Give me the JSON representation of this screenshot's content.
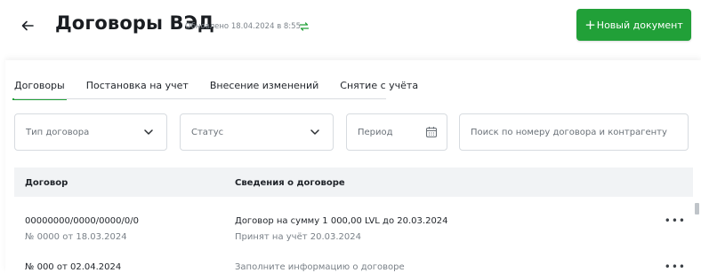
{
  "header": {
    "title": "Договоры ВЭД",
    "updated": "Обновлено 18.04.2024 в 8:55",
    "new_document_label": "Новый документ",
    "back_icon": "arrow-left-icon",
    "refresh_icon": "refresh-icon",
    "accent_color": "#21a038"
  },
  "tabs": [
    {
      "label": "Договоры",
      "active": true
    },
    {
      "label": "Постановка на учет",
      "active": false
    },
    {
      "label": "Внесение изменений",
      "active": false
    },
    {
      "label": "Снятие с учёта",
      "active": false
    }
  ],
  "filters": {
    "contract_type": {
      "placeholder": "Тип договора"
    },
    "status": {
      "placeholder": "Статус"
    },
    "period": {
      "placeholder": "Период"
    },
    "search": {
      "placeholder": "Поиск по номеру договора и контрагенту"
    }
  },
  "table": {
    "columns": [
      "Договор",
      "Сведения о договоре"
    ],
    "rows": [
      {
        "contract": "00000000/0000/0000/0/0",
        "contract_sub": "№ 0000 от 18.03.2024",
        "info": "Договор на сумму 1 000,00 LVL до 20.03.2024",
        "info_sub": "Принят на учёт 20.03.2024"
      },
      {
        "contract": "№ 000 от 02.04.2024",
        "contract_sub": "",
        "info": "Заполните информацию о договоре",
        "info_sub": ""
      }
    ],
    "more_label": "•••"
  }
}
